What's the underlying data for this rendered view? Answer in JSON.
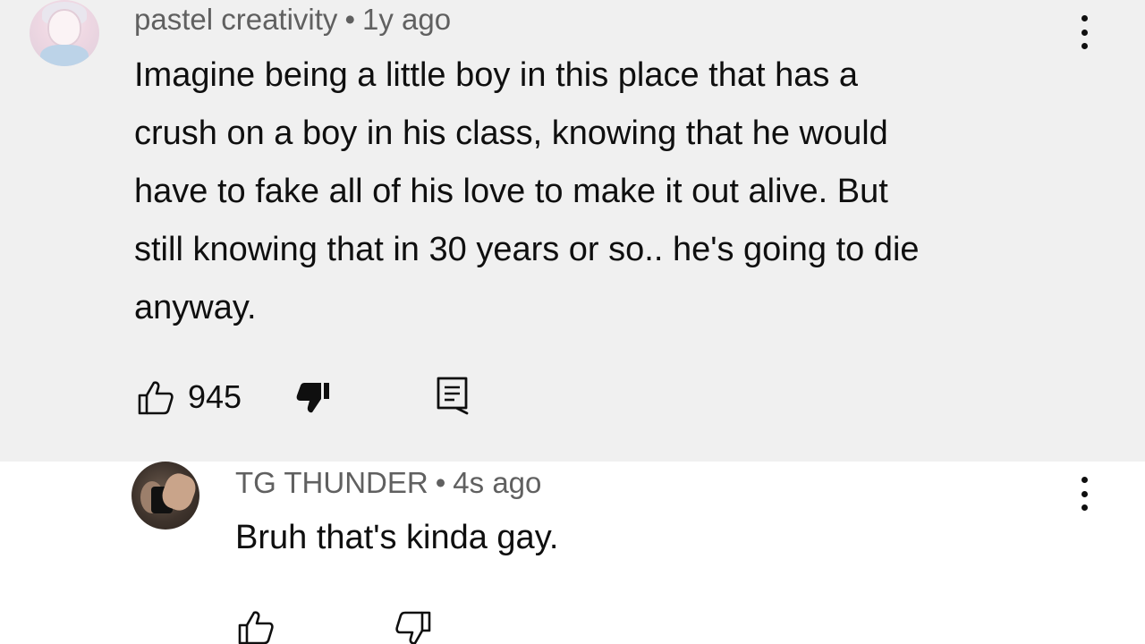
{
  "main_comment": {
    "author": "pastel creativity",
    "separator": "•",
    "time": "1y ago",
    "text": "Imagine being a little boy in this place that has a\ncrush on a boy in his class, knowing that he would\nhave to fake all of his love to make it out alive. But\nstill knowing that in 30 years or so.. he's going to die\nanyway.",
    "like_count": "945",
    "icons": {
      "like": "thumbs-up-icon",
      "dislike": "thumbs-down-icon",
      "reply": "reply-icon",
      "menu": "more-vertical-icon"
    }
  },
  "reply_comment": {
    "author": "TG THUNDER",
    "separator": "•",
    "time": "4s ago",
    "text": "Bruh that's kinda gay.",
    "icons": {
      "like": "thumbs-up-icon",
      "dislike": "thumbs-down-icon",
      "menu": "more-vertical-icon"
    }
  },
  "colors": {
    "main_background": "#f0f0f0",
    "reply_background": "#ffffff",
    "text_primary": "#0f0f0f",
    "text_secondary": "#606060"
  }
}
